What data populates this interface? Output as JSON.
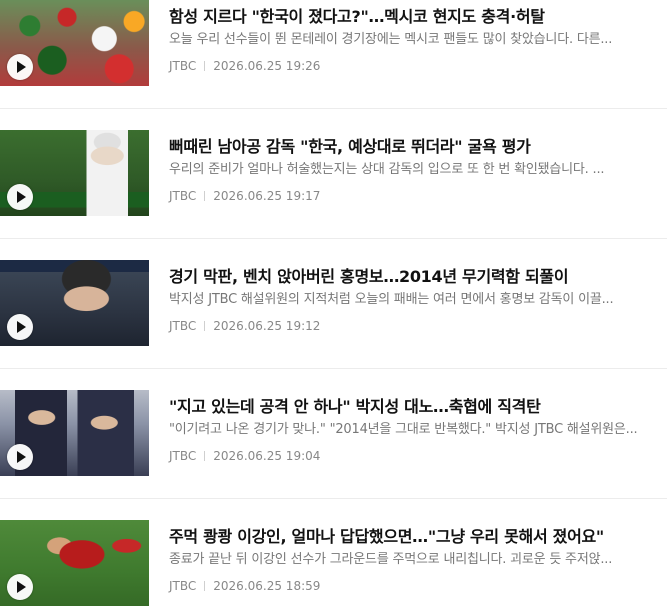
{
  "articles": [
    {
      "title": "함성 지르다 \"한국이 졌다고?\"…멕시코 현지도 충격·허탈",
      "summary": "오늘 우리 선수들이 뛴 몬테레이 경기장에는 멕시코 팬들도 많이 찾았습니다. 다른...",
      "source": "JTBC",
      "datetime": "2026.06.25  19:26",
      "icon": "play-icon"
    },
    {
      "title": "뻐때린 남아공 감독 \"한국, 예상대로 뛰더라\" 굴욕 평가",
      "summary": "우리의 준비가 얼마나 허술했는지는 상대 감독의 입으로 또 한 번 확인됐습니다. ...",
      "source": "JTBC",
      "datetime": "2026.06.25  19:17",
      "icon": "play-icon"
    },
    {
      "title": "경기 막판, 벤치 앉아버린 홍명보…2014년 무기력함 되풀이",
      "summary": "박지성 JTBC 해설위원의 지적처럼 오늘의 패배는 여러 면에서 홍명보 감독이 이끌...",
      "source": "JTBC",
      "datetime": "2026.06.25  19:12",
      "icon": "play-icon"
    },
    {
      "title": "\"지고 있는데 공격 안 하나\" 박지성 대노…축협에 직격탄",
      "summary": "\"이기려고 나온 경기가 맞나.\" \"2014년을 그대로 반복했다.\" 박지성 JTBC 해설위원은...",
      "source": "JTBC",
      "datetime": "2026.06.25  19:04",
      "icon": "play-icon"
    },
    {
      "title": "주먹 쾅쾅 이강인, 얼마나 답답했으면…\"그냥 우리 못해서 졌어요\"",
      "summary": "종료가 끝난 뒤 이강인 선수가 그라운드를 주먹으로 내리칩니다. 괴로운 듯 주저앉...",
      "source": "JTBC",
      "datetime": "2026.06.25  18:59",
      "icon": "play-icon"
    }
  ],
  "colors": {
    "title": "#111111",
    "summary": "#777777",
    "meta": "#888888",
    "divider": "#ececec"
  }
}
